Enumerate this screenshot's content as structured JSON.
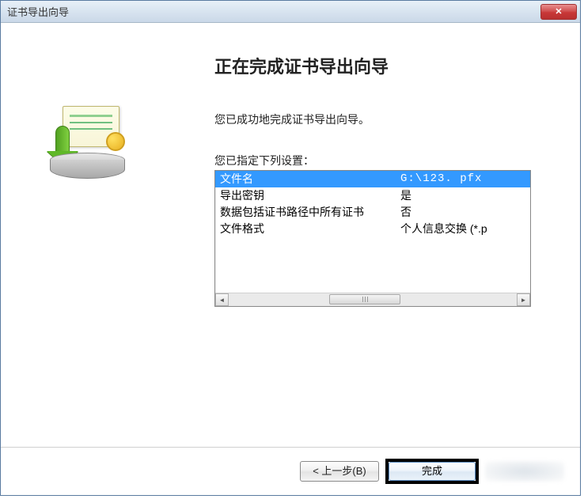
{
  "title": "证书导出向导",
  "close_glyph": "✕",
  "heading": "正在完成证书导出向导",
  "success_text": "您已成功地完成证书导出向导。",
  "settings_label": "您已指定下列设置：",
  "settings": [
    {
      "label": "文件名",
      "value": "G:\\123. pfx"
    },
    {
      "label": "导出密钥",
      "value": "是"
    },
    {
      "label": "数据包括证书路径中所有证书",
      "value": "否"
    },
    {
      "label": "文件格式",
      "value": "个人信息交换 (*.p"
    }
  ],
  "buttons": {
    "back": "< 上一步(B)",
    "finish": "完成"
  }
}
